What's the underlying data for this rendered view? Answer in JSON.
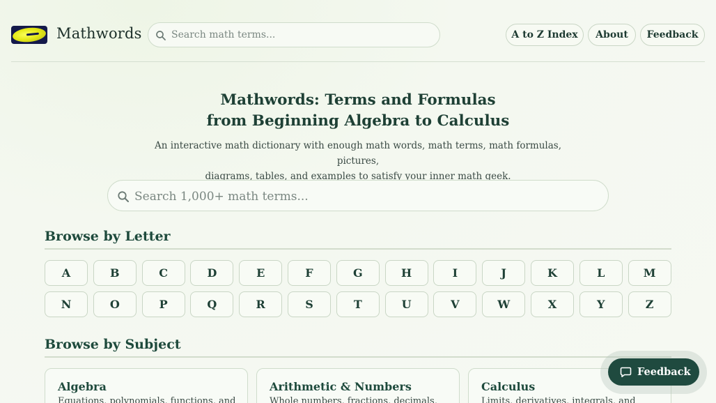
{
  "header": {
    "brand": "Mathwords",
    "search_placeholder": "Search math terms...",
    "nav": [
      "A to Z Index",
      "About",
      "Feedback"
    ]
  },
  "hero": {
    "title_line1": "Mathwords: Terms and Formulas",
    "title_line2": "from Beginning Algebra to Calculus",
    "subtitle_line1": "An interactive math dictionary with enough math words, math terms, math formulas, pictures,",
    "subtitle_line2": "diagrams, tables, and examples to satisfy your inner math geek.",
    "search_placeholder": "Search 1,000+ math terms..."
  },
  "letters_section": {
    "heading": "Browse by Letter",
    "letters": [
      "A",
      "B",
      "C",
      "D",
      "E",
      "F",
      "G",
      "H",
      "I",
      "J",
      "K",
      "L",
      "M",
      "N",
      "O",
      "P",
      "Q",
      "R",
      "S",
      "T",
      "U",
      "V",
      "W",
      "X",
      "Y",
      "Z"
    ]
  },
  "subjects_section": {
    "heading": "Browse by Subject",
    "cards": [
      {
        "title": "Algebra",
        "desc": "Equations, polynomials, functions, and"
      },
      {
        "title": "Arithmetic & Numbers",
        "desc": "Whole numbers, fractions, decimals,"
      },
      {
        "title": "Calculus",
        "desc": "Limits, derivatives, integrals, and"
      }
    ]
  },
  "feedback_fab": {
    "label": "Feedback"
  },
  "colors": {
    "accent": "#1f4a3f",
    "background": "#f4f8f0",
    "heading": "#1e4a3c"
  }
}
